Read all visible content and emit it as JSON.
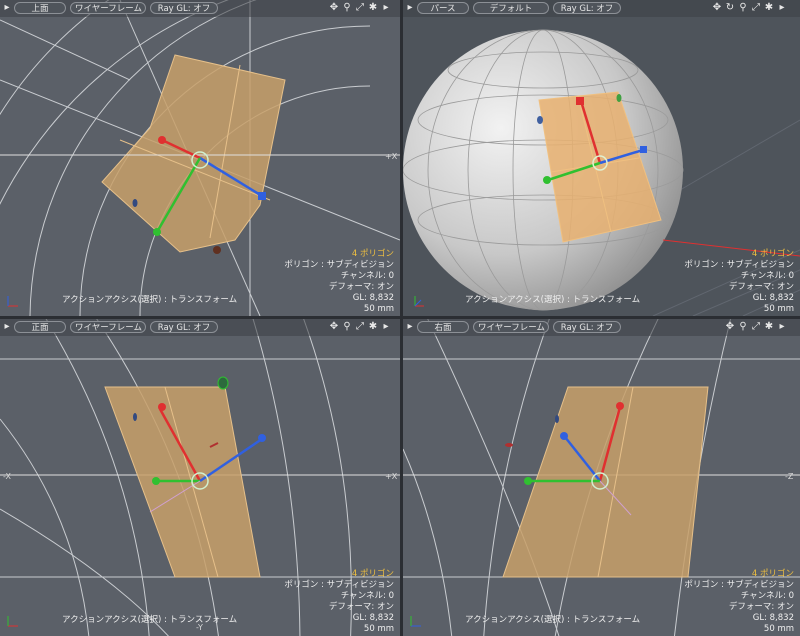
{
  "viewports": [
    {
      "id": "top-left",
      "view_label": "上面",
      "shading_label": "ワイヤーフレーム",
      "ray_label": "Ray GL: オフ",
      "axis_right": "+X",
      "info": {
        "polygons": "4 ポリゴン",
        "polygon_type": "ポリゴン : サブディビジョン",
        "channel": "チャンネル: 0",
        "deformer": "デフォーマ: オン",
        "gl": "GL: 8,832",
        "scale": "50 mm"
      },
      "action": "アクションアクシス(選択) : トランスフォーム"
    },
    {
      "id": "top-right",
      "view_label": "パース",
      "shading_label": "デフォルト",
      "ray_label": "Ray GL: オフ",
      "info": {
        "polygons": "4 ポリゴン",
        "polygon_type": "ポリゴン : サブディビジョン",
        "channel": "チャンネル: 0",
        "deformer": "デフォーマ: オン",
        "gl": "GL: 8,832",
        "scale": "50 mm"
      },
      "action": "アクションアクシス(選択) : トランスフォーム"
    },
    {
      "id": "bottom-left",
      "view_label": "正面",
      "shading_label": "ワイヤーフレーム",
      "ray_label": "Ray GL: オフ",
      "axis_right": "+X",
      "axis_left": "-X",
      "axis_bottom": "-Y",
      "info": {
        "polygons": "4 ポリゴン",
        "polygon_type": "ポリゴン : サブディビジョン",
        "channel": "チャンネル: 0",
        "deformer": "デフォーマ: オン",
        "gl": "GL: 8,832",
        "scale": "50 mm"
      },
      "action": "アクションアクシス(選択) : トランスフォーム"
    },
    {
      "id": "bottom-right",
      "view_label": "右面",
      "shading_label": "ワイヤーフレーム",
      "ray_label": "Ray GL: オフ",
      "axis_right": "-Z",
      "info": {
        "polygons": "4 ポリゴン",
        "polygon_type": "ポリゴン : サブディビジョン",
        "channel": "チャンネル: 0",
        "deformer": "デフォーマ: オン",
        "gl": "GL: 8,832",
        "scale": "50 mm"
      },
      "action": "アクションアクシス(選択) : トランスフォーム"
    }
  ],
  "toolbar_icons": [
    "move-view-icon",
    "zoom-icon",
    "maximize-icon",
    "settings-icon",
    "menu-arrow-icon"
  ],
  "colors": {
    "viewport_bg": "#5b6068",
    "selection_fill": "#c8a06a",
    "axis_x": "#e03030",
    "axis_y": "#30c030",
    "axis_z": "#3060e0",
    "highlight_text": "#f0c040"
  }
}
